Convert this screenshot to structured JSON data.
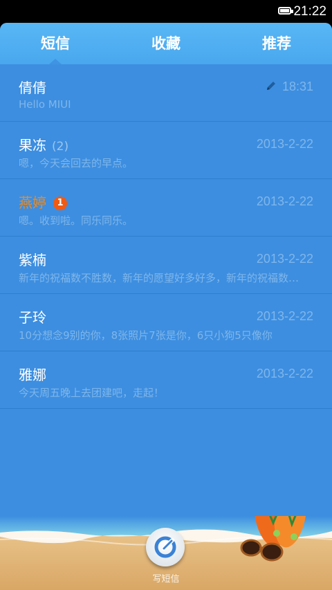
{
  "status_bar": {
    "time": "21:22"
  },
  "tabs": [
    {
      "label": "短信",
      "active": true
    },
    {
      "label": "收藏",
      "active": false
    },
    {
      "label": "推荐",
      "active": false
    }
  ],
  "conversations": [
    {
      "name": "倩倩",
      "count": "",
      "badge": "",
      "date": "18:31",
      "preview": "Hello MIUI",
      "draft": true,
      "unread": false
    },
    {
      "name": "果冻",
      "count": "(2)",
      "badge": "",
      "date": "2013-2-22",
      "preview": "嗯，今天会回去的早点。",
      "draft": false,
      "unread": false
    },
    {
      "name": "燕婷",
      "count": "",
      "badge": "1",
      "date": "2013-2-22",
      "preview": "嗯。收到啦。同乐同乐。",
      "draft": false,
      "unread": true
    },
    {
      "name": "紫楠",
      "count": "",
      "badge": "",
      "date": "2013-2-22",
      "preview": "新年的祝福数不胜数，新年的愿望好多好多，新年的祝福数不胜数",
      "draft": false,
      "unread": false
    },
    {
      "name": "子玲",
      "count": "",
      "badge": "",
      "date": "2013-2-22",
      "preview": "10分想念9别的你，8张照片7张是你，6只小狗5只像你",
      "draft": false,
      "unread": false
    },
    {
      "name": "雅娜",
      "count": "",
      "badge": "",
      "date": "2013-2-22",
      "preview": "今天周五晚上去团建吧，走起！",
      "draft": false,
      "unread": false
    }
  ],
  "compose": {
    "label": "写短信"
  },
  "colors": {
    "accent": "#3d8ee0",
    "tab_bar": "#4fb0f2",
    "unread_name": "#f08a1a",
    "badge": "#f05a12"
  }
}
